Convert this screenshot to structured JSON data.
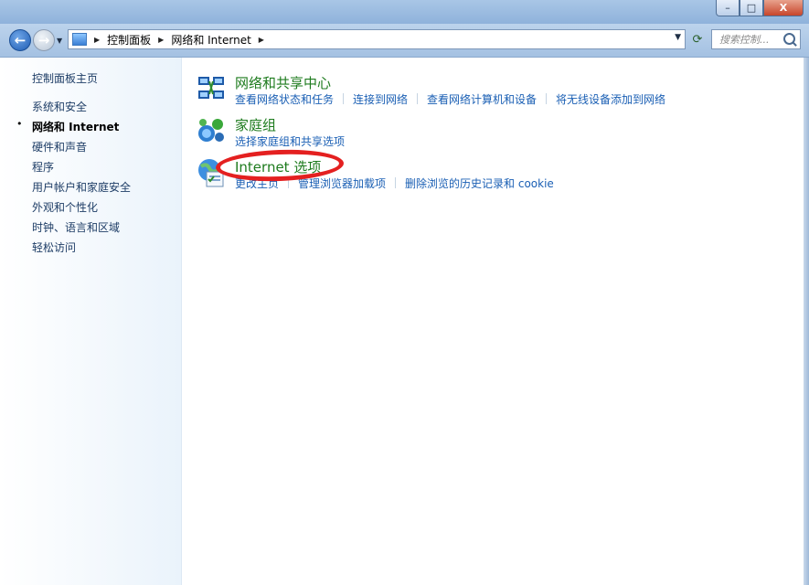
{
  "window": {
    "controls": {
      "minimize": "–",
      "maximize": "□",
      "close": "X"
    }
  },
  "nav": {
    "back_icon": "back-arrow-icon",
    "back_glyph": "←",
    "forward_glyph": "→",
    "dropdown_glyph": "▼",
    "breadcrumbs": [
      "控制面板",
      "网络和 Internet"
    ],
    "address_dropdown": "▼",
    "refresh_glyph": "⟳",
    "search_placeholder": "搜索控制..."
  },
  "sidebar": {
    "home": "控制面板主页",
    "items": [
      {
        "label": "系统和安全",
        "current": false
      },
      {
        "label": "网络和 Internet",
        "current": true
      },
      {
        "label": "硬件和声音",
        "current": false
      },
      {
        "label": "程序",
        "current": false
      },
      {
        "label": "用户帐户和家庭安全",
        "current": false
      },
      {
        "label": "外观和个性化",
        "current": false
      },
      {
        "label": "时钟、语言和区域",
        "current": false
      },
      {
        "label": "轻松访问",
        "current": false
      }
    ],
    "bullet": "•"
  },
  "categories": [
    {
      "title": "网络和共享中心",
      "icon": "network-sharing-center-icon",
      "links": [
        "查看网络状态和任务",
        "连接到网络",
        "查看网络计算机和设备",
        "将无线设备添加到网络"
      ]
    },
    {
      "title": "家庭组",
      "icon": "homegroup-icon",
      "links": [
        "选择家庭组和共享选项"
      ]
    },
    {
      "title": "Internet 选项",
      "icon": "internet-options-icon",
      "links": [
        "更改主页",
        "管理浏览器加载项",
        "删除浏览的历史记录和 cookie"
      ]
    }
  ],
  "colors": {
    "category_title": "#1e7b1e",
    "link": "#1a5fb4",
    "highlight_ring": "#e42020"
  }
}
